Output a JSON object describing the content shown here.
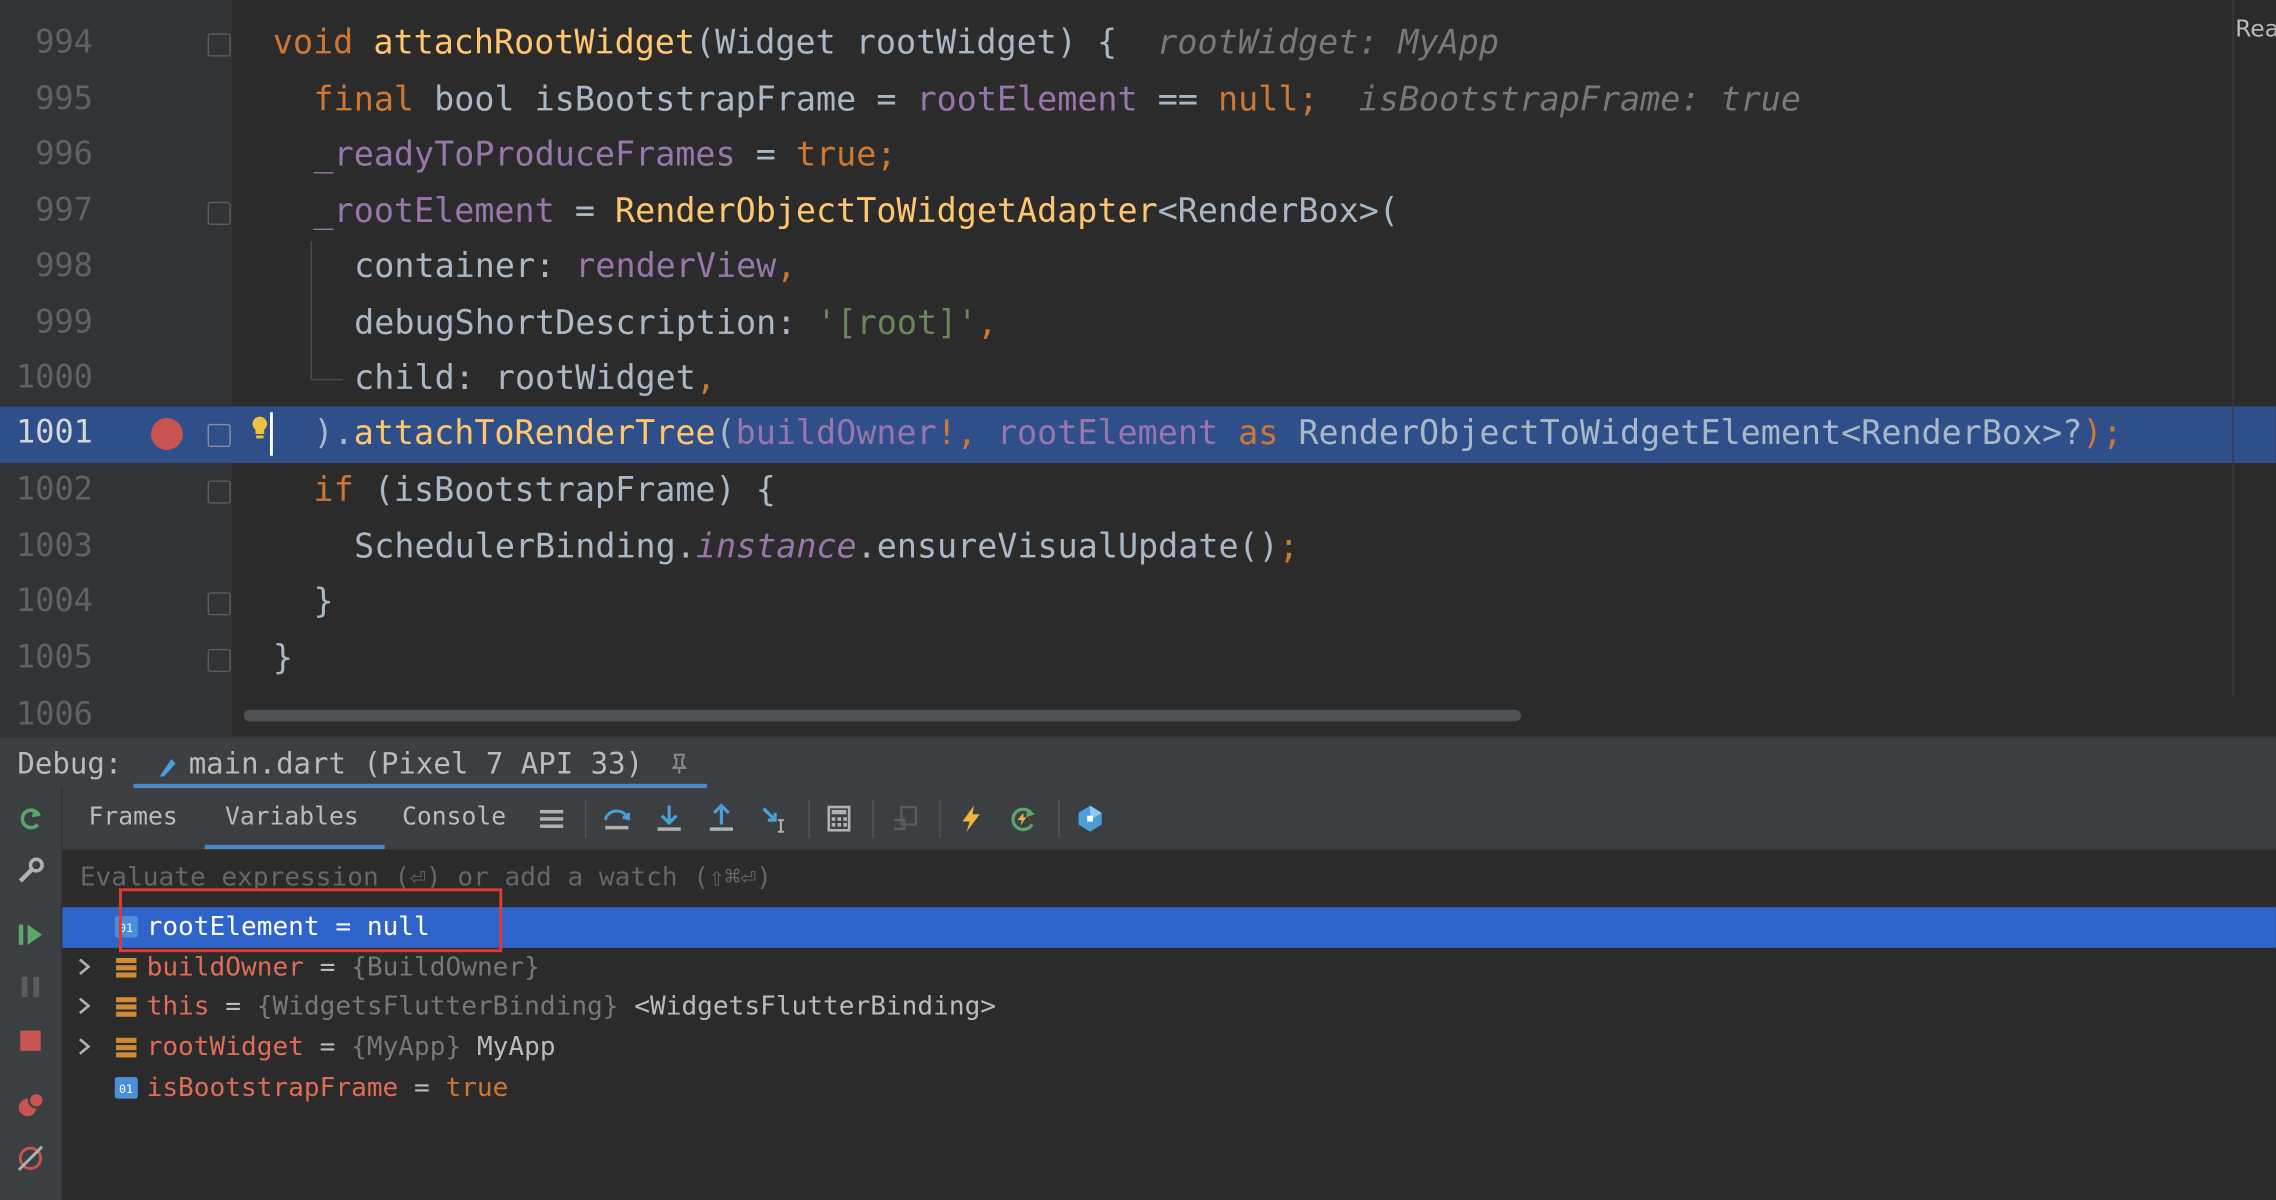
{
  "editor": {
    "right_edge_text": "Rea",
    "lines": [
      {
        "num": "994"
      },
      {
        "num": "995"
      },
      {
        "num": "996"
      },
      {
        "num": "997"
      },
      {
        "num": "998"
      },
      {
        "num": "999"
      },
      {
        "num": "1000"
      },
      {
        "num": "1001"
      },
      {
        "num": "1002"
      },
      {
        "num": "1003"
      },
      {
        "num": "1004"
      },
      {
        "num": "1005"
      },
      {
        "num": "1006"
      }
    ],
    "tokens": {
      "l994_void": "void",
      "l994_fn": "attachRootWidget",
      "l994_rest": "(Widget rootWidget) {",
      "l994_hint": "rootWidget: MyApp",
      "l995_final": "final",
      "l995_bool": " bool isBootstrapFrame = ",
      "l995_field": "rootElement",
      "l995_eq": " == ",
      "l995_null": "null",
      "l995_semi": ";",
      "l995_hint": "isBootstrapFrame: true",
      "l996_field": "_readyToProduceFrames",
      "l996_eq": " = ",
      "l996_true": "true",
      "l996_semi": ";",
      "l997_field": "_rootElement",
      "l997_eq": " = ",
      "l997_cls": "RenderObjectToWidgetAdapter",
      "l997_gen": "<RenderBox>(",
      "l998_name": "container: ",
      "l998_val": "renderView",
      "l998_comma": ",",
      "l999_name": "debugShortDescription: ",
      "l999_str": "'[root]'",
      "l999_comma": ",",
      "l1000_name": "child: rootWidget",
      "l1000_comma": ",",
      "l1001_a": ").",
      "l1001_fn": "attachToRenderTree",
      "l1001_p": "(",
      "l1001_owner": "buildOwner",
      "l1001_bang": "!, ",
      "l1001_field": "rootElement",
      "l1001_as": " as ",
      "l1001_type": "RenderObjectToWidgetElement<RenderBox>?",
      "l1001_end": ");",
      "l1002_if": "if",
      "l1002_rest": " (isBootstrapFrame) {",
      "l1003_cls": "SchedulerBinding.",
      "l1003_inst": "instance",
      "l1003_rest": ".ensureVisualUpdate()",
      "l1003_semi": ";",
      "l1004": "}",
      "l1005": "}"
    }
  },
  "debug": {
    "label": "Debug:",
    "session": "main.dart (Pixel 7 API 33)",
    "tabs": [
      {
        "label": "Frames"
      },
      {
        "label": "Variables"
      },
      {
        "label": "Console"
      }
    ],
    "eval_placeholder": "Evaluate expression (⏎) or add a watch (⇧⌘⏎)",
    "variables": [
      {
        "name": "rootElement",
        "sep": " = ",
        "value": "null",
        "type": "",
        "extra": ""
      },
      {
        "name": "buildOwner",
        "sep": " = ",
        "value": "",
        "type": "{BuildOwner}",
        "extra": ""
      },
      {
        "name": "this",
        "sep": " = ",
        "value": "",
        "type": "{WidgetsFlutterBinding}",
        "extra": " <WidgetsFlutterBinding>"
      },
      {
        "name": "rootWidget",
        "sep": " = ",
        "value": "",
        "type": "{MyApp}",
        "extra": " MyApp"
      },
      {
        "name": "isBootstrapFrame",
        "sep": " = ",
        "value": "true",
        "type": "",
        "extra": ""
      }
    ]
  },
  "colors": {
    "highlight_line": "#2e4f8a",
    "selected_row": "#2f65ca",
    "breakpoint": "#c75450",
    "annotation_box": "#e03a30"
  }
}
